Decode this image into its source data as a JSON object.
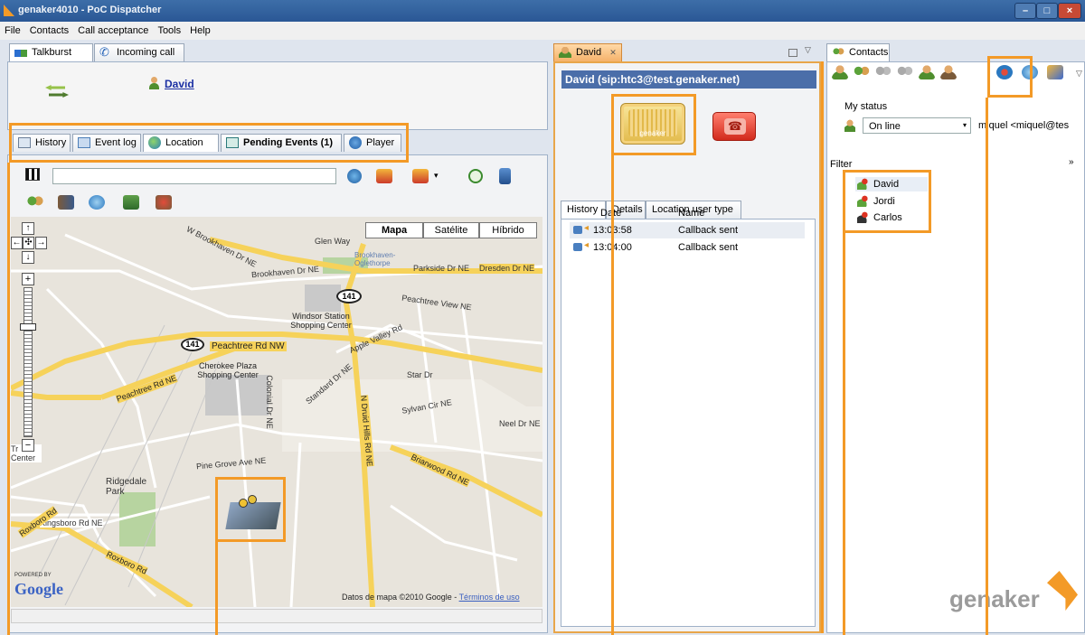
{
  "window": {
    "title": "genaker4010 - PoC Dispatcher"
  },
  "menu": [
    "File",
    "Contacts",
    "Call acceptance",
    "Tools",
    "Help"
  ],
  "top_tabs": {
    "talkburst": "Talkburst",
    "incoming": "Incoming call"
  },
  "talkburst": {
    "user": "David"
  },
  "bottom_tabs": {
    "history": "History",
    "eventlog": "Event log",
    "location": "Location",
    "pending": "Pending Events (1)",
    "player": "Player"
  },
  "map": {
    "buttons": {
      "map": "Mapa",
      "satellite": "Satélite",
      "hybrid": "Híbrido"
    },
    "labels": [
      "W Brookhaven Dr NE",
      "Brookhaven Dr NE",
      "Brookhaven-Oglethorpe",
      "Dresden Dr NE",
      "Parkside Dr NE",
      "Peachtree View NE",
      "Windsor Station Shopping Center",
      "Peachtree Rd NW",
      "Cherokee Plaza Shopping Center",
      "Peachtree Rd NE",
      "Apple Valley Rd",
      "Star Dr",
      "Sylvan Cir NE",
      "Standard Dr NE",
      "N Druid Hills Rd NE",
      "Neel Dr NE",
      "Briarwood Rd NE",
      "Pine Grove Ave NE",
      "Ridgedale Park",
      "Kingsboro Rd NE",
      "Roxboro Rd",
      "Colonial Dr NE",
      "Glen Way",
      "Tr Center",
      "141"
    ],
    "attribution": "Datos de mapa ©2010 Google -",
    "terms": "Términos de uso",
    "powered": "POWERED BY",
    "google": "Google"
  },
  "david_panel": {
    "tab": "David",
    "header": "David (sip:htc3@test.genaker.net)",
    "logo_text": "genaker",
    "tabs": [
      "History",
      "Details",
      "Location user type"
    ],
    "columns": [
      "Date",
      "Name"
    ],
    "rows": [
      {
        "date": "13:03:58",
        "name": "Callback sent"
      },
      {
        "date": "13:04:00",
        "name": "Callback sent"
      }
    ]
  },
  "contacts": {
    "tab": "Contacts",
    "my_status_label": "My status",
    "status": "On line",
    "user": "miquel <miquel@tes",
    "filter_label": "Filter",
    "items": [
      "David",
      "Jordi",
      "Carlos"
    ]
  },
  "brand": {
    "logo": "genaker",
    "accent": "#f39a27"
  }
}
